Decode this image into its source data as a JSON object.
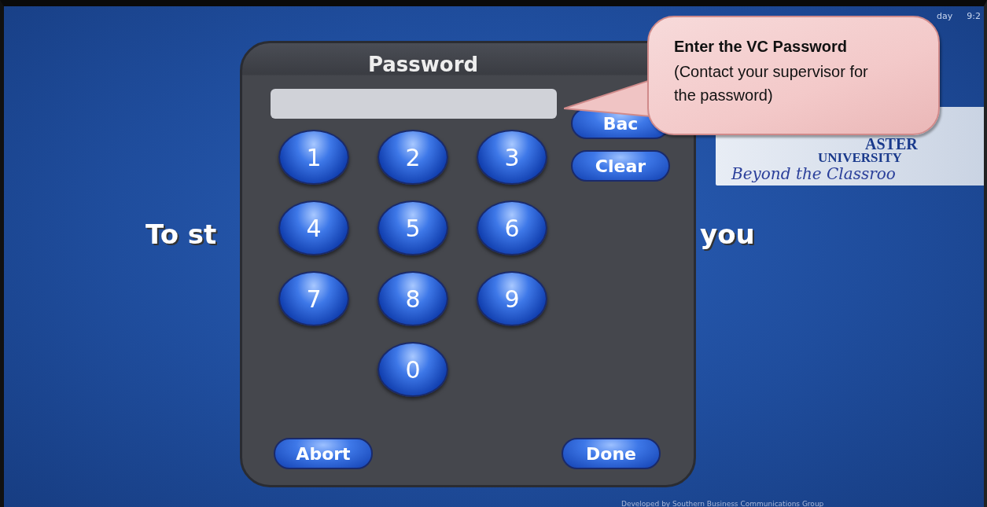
{
  "status": {
    "day": "day",
    "time": "9:2"
  },
  "logo": {
    "name": "ASTER",
    "line2": "UNIVERSITY",
    "tagline": "Beyond the Classroo"
  },
  "background_text": [
    "To st",
    "you"
  ],
  "dialog": {
    "title": "Password",
    "keypad": [
      [
        "1",
        "2",
        "3"
      ],
      [
        "4",
        "5",
        "6"
      ],
      [
        "7",
        "8",
        "9"
      ],
      [
        "0"
      ]
    ],
    "side_buttons": [
      "Bac",
      "Clear"
    ],
    "bottom_buttons": [
      "Abort",
      "Done"
    ]
  },
  "callout": {
    "title": "Enter the VC Password",
    "body": "(Contact your supervisor for the password)"
  },
  "footer": "Developed by Southern Business Communications Group"
}
